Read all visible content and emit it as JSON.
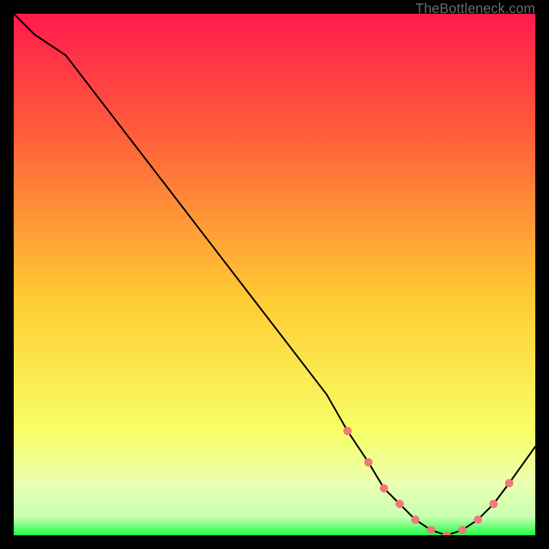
{
  "watermark": "TheBottleneck.com",
  "colors": {
    "background": "#000000",
    "gradient_top": "#ff1a4d",
    "gradient_upper": "#ff5a3a",
    "gradient_mid": "#ffcc33",
    "gradient_lower": "#f8ff66",
    "gradient_band": "#eaffb0",
    "gradient_bottom": "#1eff46",
    "curve": "#000000",
    "marker": "#f07878",
    "watermark": "#6b6b6b"
  },
  "chart_data": {
    "type": "line",
    "title": "",
    "xlabel": "",
    "ylabel": "",
    "xlim": [
      0,
      100
    ],
    "ylim": [
      0,
      100
    ],
    "series": [
      {
        "name": "bottleneck-curve",
        "x": [
          0,
          4,
          10,
          20,
          30,
          40,
          50,
          60,
          64,
          68,
          71,
          74,
          77,
          80,
          83,
          86,
          89,
          92,
          95,
          100
        ],
        "y": [
          100,
          96,
          92,
          79,
          66,
          53,
          40,
          27,
          20,
          14,
          9,
          6,
          3,
          1,
          0,
          1,
          3,
          6,
          10,
          17
        ]
      }
    ],
    "markers": {
      "name": "highlight-points",
      "x": [
        64,
        68,
        71,
        74,
        77,
        80,
        83,
        86,
        89,
        92,
        95
      ],
      "y": [
        20,
        14,
        9,
        6,
        3,
        1,
        0,
        1,
        3,
        6,
        10
      ]
    }
  }
}
